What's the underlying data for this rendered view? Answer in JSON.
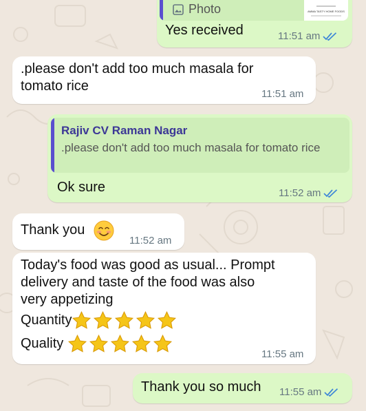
{
  "colors": {
    "chat_background": "#efe7de",
    "incoming_bubble": "#ffffff",
    "outgoing_bubble": "#dcf8c6",
    "quote_background": "#cfeeb9",
    "quote_accent": "#5a4fcf",
    "read_ticks": "#3d86d8",
    "star": "#f5c518"
  },
  "messages": {
    "m1": {
      "direction": "outgoing",
      "reply_preview_icon": "photo-icon",
      "reply_preview_label": "Photo",
      "thumbnail_caption_line1": "AMMA TASTY HOME FOODS",
      "text": "Yes received",
      "time": "11:51 am",
      "status": "read"
    },
    "m2": {
      "direction": "incoming",
      "line1": ".please don't add too much masala for",
      "line2": "tomato rice",
      "time": "11:51 am"
    },
    "m3": {
      "direction": "outgoing",
      "quoted_author": "Rajiv CV Raman Nagar",
      "quoted_text": ".please don't add too much masala for tomato rice",
      "text": "Ok sure",
      "time": "11:52 am",
      "status": "read"
    },
    "m4": {
      "direction": "incoming",
      "text": "Thank you",
      "emoji": "smiling-face-emoji",
      "time": "11:52 am"
    },
    "m5": {
      "direction": "incoming",
      "line1": "Today's food was good as usual... Prompt",
      "line2": "delivery and taste of the food was also",
      "line3": "very appetizing",
      "rating1_label": "Quantity",
      "rating1_stars": 5,
      "rating2_label": "Quality",
      "rating2_stars": 5,
      "time": "11:55 am"
    },
    "m6": {
      "direction": "outgoing",
      "text": "Thank you so much",
      "time": "11:55 am",
      "status": "read"
    }
  }
}
